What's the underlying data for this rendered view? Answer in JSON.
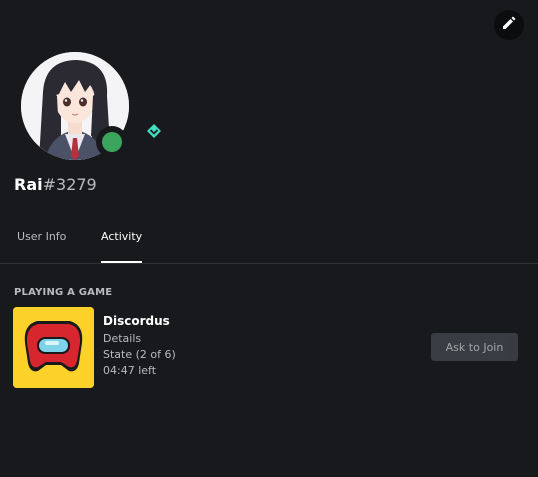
{
  "profile": {
    "username": "Rai",
    "discriminator": "#3279",
    "avatar_icon": "anime-girl-avatar",
    "status": "online",
    "status_color": "#3ba55d",
    "badge_icon": "hypesquad-balance-badge",
    "badge_color": "#45ddc0"
  },
  "header": {
    "edit_icon": "pencil-icon"
  },
  "tabs": [
    {
      "label": "User Info",
      "active": false
    },
    {
      "label": "Activity",
      "active": true
    }
  ],
  "activity": {
    "section_title": "PLAYING A GAME",
    "game_image_icon": "among-us-crewmate-controller",
    "game_image_bg": "#fcd12a",
    "name": "Discordus",
    "details": "Details",
    "state": "State (2 of 6)",
    "time_left": "04:47 left",
    "join_button_label": "Ask to Join"
  }
}
